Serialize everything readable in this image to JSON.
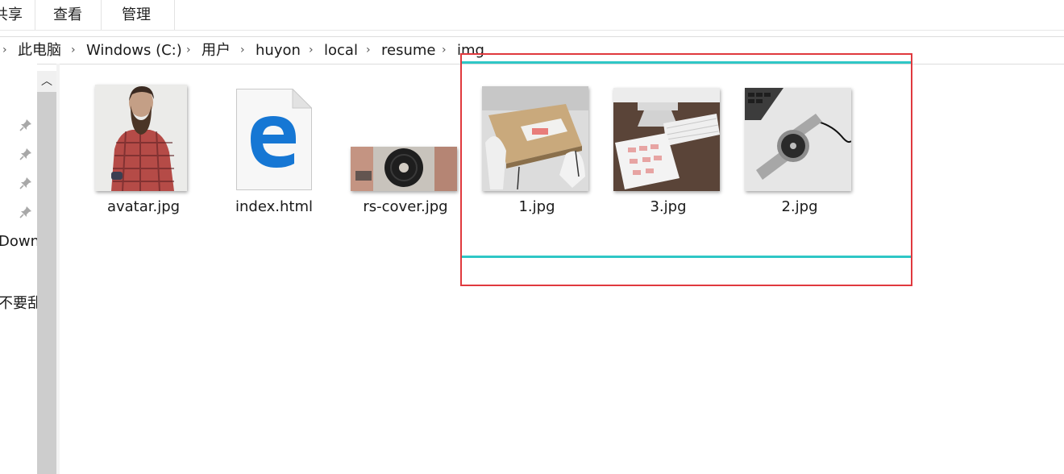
{
  "ribbon": {
    "tabs": [
      {
        "label": "共享"
      },
      {
        "label": "查看"
      },
      {
        "label": "管理"
      }
    ]
  },
  "address_bar": {
    "crumbs": [
      "此电脑",
      "Windows (C:)",
      "用户",
      "huyon",
      "local",
      "resume",
      "img"
    ]
  },
  "nav_pane": {
    "items": [
      "Down",
      "不要乱"
    ]
  },
  "files": [
    {
      "name": "avatar.jpg",
      "icon": "portrait-photo-thumbnail"
    },
    {
      "name": "index.html",
      "icon": "edge-html-icon"
    },
    {
      "name": "rs-cover.jpg",
      "icon": "vinyl-photo-thumbnail"
    },
    {
      "name": "1.jpg",
      "icon": "desk-photo-thumbnail"
    },
    {
      "name": "3.jpg",
      "icon": "keyboard-tablet-photo-thumbnail"
    },
    {
      "name": "2.jpg",
      "icon": "watch-photo-thumbnail"
    }
  ],
  "colors": {
    "highlight_box": "#e0393e",
    "highlight_lines": "#2fc7c6",
    "edge_blue": "#1677d4"
  }
}
